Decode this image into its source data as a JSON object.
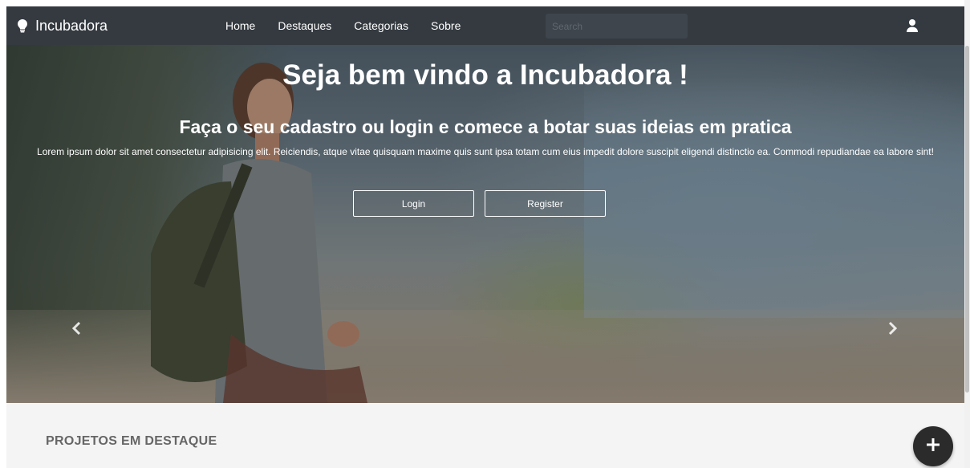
{
  "navbar": {
    "brand": "Incubadora",
    "links": [
      "Home",
      "Destaques",
      "Categorias",
      "Sobre"
    ],
    "search_placeholder": "Search",
    "icons": {
      "brand": "lightbulb-icon",
      "user": "user-icon"
    }
  },
  "hero": {
    "title_prefix": "Seja bem vindo a ",
    "title_bold": "Incubadora",
    "title_suffix": " !",
    "subtitle": "Faça o seu cadastro ou login e comece a botar suas ideias em pratica",
    "text": "Lorem ipsum dolor sit amet consectetur adipisicing elit. Reiciendis, atque vitae quisquam maxime quis sunt ipsa totam cum eius impedit dolore suscipit eligendi distinctio ea. Commodi repudiandae ea labore sint!",
    "login_label": "Login",
    "register_label": "Register",
    "icons": {
      "prev": "chevron-left-icon",
      "next": "chevron-right-icon"
    }
  },
  "section": {
    "title": "PROJETOS EM DESTAQUE"
  },
  "fab": {
    "icon": "plus-icon"
  },
  "colors": {
    "navbar": "#343a40",
    "page_background": "#f4f4f4",
    "fab": "#2b2b2b"
  }
}
